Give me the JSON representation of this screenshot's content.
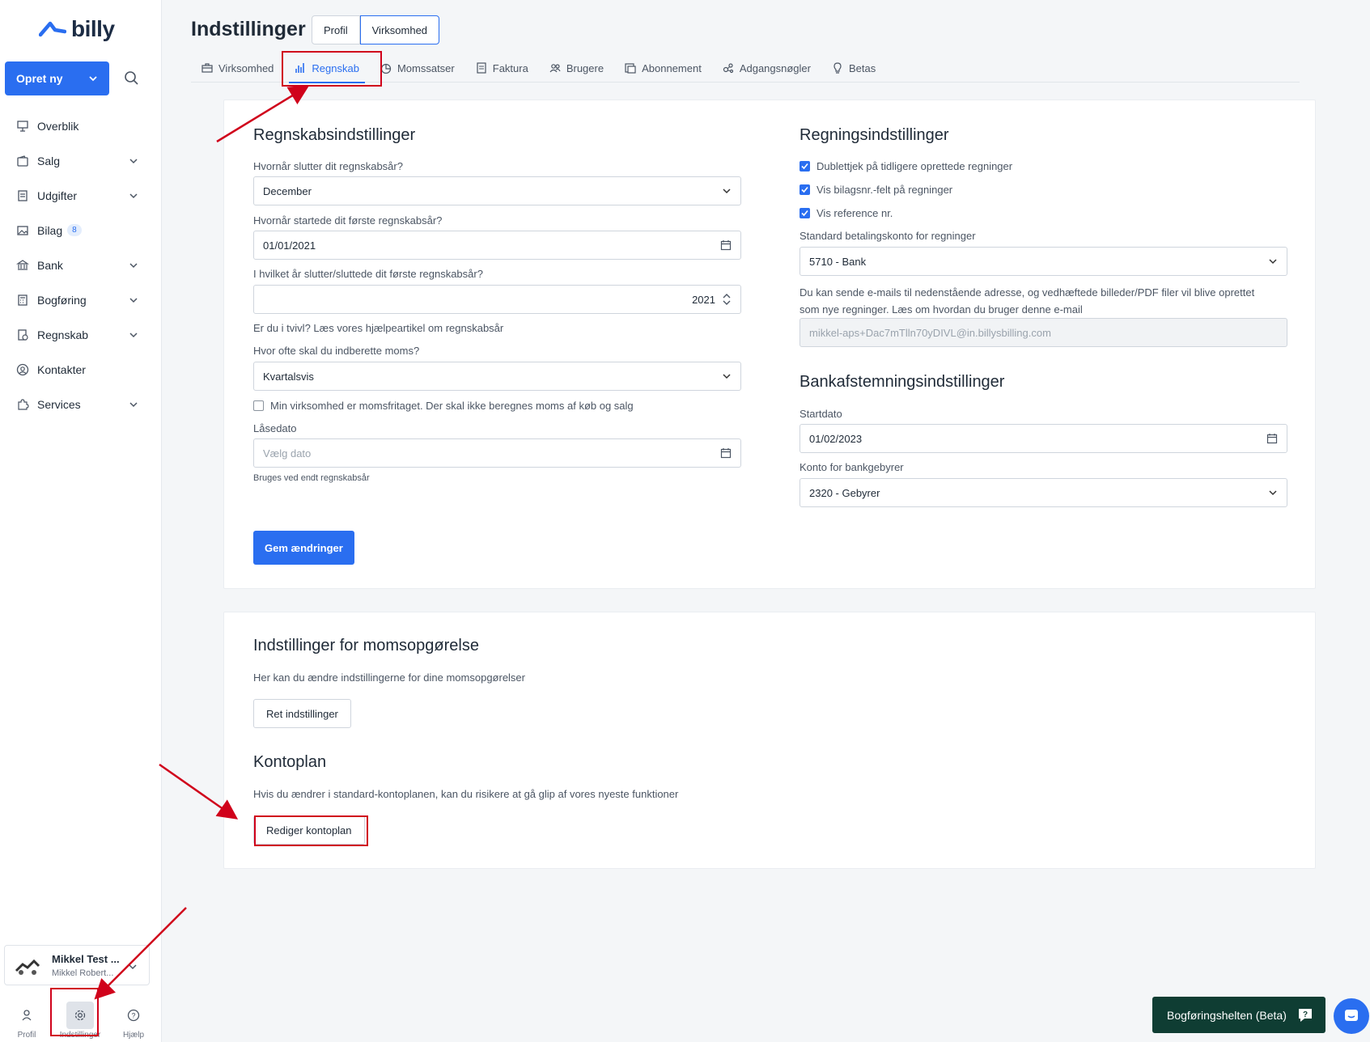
{
  "sidebar": {
    "logo_text": "billy",
    "create_button": "Opret ny",
    "nav": [
      {
        "label": "Overblik",
        "icon": "presentation-icon",
        "has_chevron": false
      },
      {
        "label": "Salg",
        "icon": "wallet-icon",
        "has_chevron": true
      },
      {
        "label": "Udgifter",
        "icon": "receipt-icon",
        "has_chevron": true
      },
      {
        "label": "Bilag",
        "icon": "image-icon",
        "badge": "8",
        "has_chevron": false
      },
      {
        "label": "Bank",
        "icon": "bank-icon",
        "has_chevron": true
      },
      {
        "label": "Bogføring",
        "icon": "calculator-icon",
        "has_chevron": true
      },
      {
        "label": "Regnskab",
        "icon": "report-icon",
        "has_chevron": true
      },
      {
        "label": "Kontakter",
        "icon": "contact-icon",
        "has_chevron": false
      },
      {
        "label": "Services",
        "icon": "puzzle-icon",
        "has_chevron": true
      }
    ],
    "user": {
      "name": "Mikkel Test ...",
      "sub": "Mikkel Robert..."
    },
    "bottom": {
      "profil": "Profil",
      "indstillinger": "Indstillinger",
      "hjaelp": "Hjælp"
    }
  },
  "header": {
    "title": "Indstillinger",
    "seg_profil": "Profil",
    "seg_virksomhed": "Virksomhed"
  },
  "tabs": {
    "virksomhed": "Virksomhed",
    "regnskab": "Regnskab",
    "momssatser": "Momssatser",
    "faktura": "Faktura",
    "brugere": "Brugere",
    "abonnement": "Abonnement",
    "adgangsnogler": "Adgangsnøgler",
    "betas": "Betas"
  },
  "regnskab": {
    "title": "Regnskabsindstillinger",
    "q_end": "Hvornår slutter dit regnskabsår?",
    "end_value": "December",
    "q_start": "Hvornår startede dit første regnskabsår?",
    "start_value": "01/01/2021",
    "q_first_year": "I hvilket år slutter/sluttede dit første regnskabsår?",
    "first_year_value": "2021",
    "help_text": "Er du i tvivl? Læs vores hjælpeartikel om regnskabsår",
    "q_moms": "Hvor ofte skal du indberette moms?",
    "moms_value": "Kvartalsvis",
    "momsfri_label": "Min virksomhed er momsfritaget. Der skal ikke beregnes moms af køb og salg",
    "lock_label": "Låsedato",
    "lock_placeholder": "Vælg dato",
    "lock_hint": "Bruges ved endt regnskabsår",
    "save_button": "Gem ændringer"
  },
  "regning": {
    "title": "Regningsindstillinger",
    "cb1": "Dublettjek på tidligere oprettede regninger",
    "cb2": "Vis bilagsnr.-felt på regninger",
    "cb3": "Vis reference nr.",
    "account_label": "Standard betalingskonto for regninger",
    "account_value": "5710 -  Bank",
    "email_text_1": "Du kan sende e-mails til nedenstående adresse, og vedhæftede billeder/PDF filer vil blive oprettet",
    "email_text_2": "som nye regninger. Læs om hvordan du bruger denne e-mail",
    "email_value": "mikkel-aps+Dac7mTlln70yDIVL@in.billysbilling.com"
  },
  "bank": {
    "title": "Bankafstemningsindstillinger",
    "start_label": "Startdato",
    "start_value": "01/02/2023",
    "fee_label": "Konto for bankgebyrer",
    "fee_value": "2320 -  Gebyrer"
  },
  "moms": {
    "title": "Indstillinger for momsopgørelse",
    "text": "Her kan du ændre indstillingerne for dine momsopgørelser",
    "button": "Ret indstillinger"
  },
  "kontoplan": {
    "title": "Kontoplan",
    "text": "Hvis du ændrer i standard-kontoplanen, kan du risikere at gå glip af vores nyeste funktioner",
    "button": "Rediger kontoplan"
  },
  "helper_button": "Bogføringshelten (Beta)",
  "colors": {
    "accent": "#2a6ef0",
    "annotation": "#d0021b",
    "helper_bg": "#0f3d33"
  }
}
